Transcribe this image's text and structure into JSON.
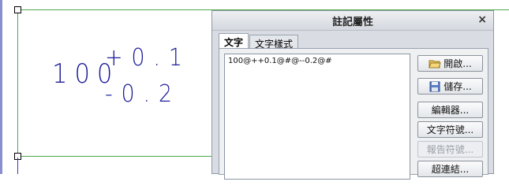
{
  "annotation": {
    "base_value": "100",
    "upper_tolerance": "+0.1",
    "lower_tolerance": "-0.2"
  },
  "dialog": {
    "title": "註記屬性",
    "close_symbol": "×",
    "tabs": [
      {
        "label": "文字",
        "active": true
      },
      {
        "label": "文字樣式",
        "active": false
      }
    ],
    "text_value": "100@++0.1@#@--0.2@#",
    "buttons": [
      {
        "label": "開啟...",
        "icon": "folder-open-icon",
        "enabled": true
      },
      {
        "label": "儲存...",
        "icon": "save-disk-icon",
        "enabled": true
      },
      {
        "label": "編輯器...",
        "enabled": true
      },
      {
        "label": "文字符號...",
        "enabled": true
      },
      {
        "label": "報告符號...",
        "enabled": false
      },
      {
        "label": "超連結...",
        "enabled": true
      }
    ]
  },
  "colors": {
    "annotation": "#1d1d9a",
    "border_green": "#4aa84a",
    "dialog_bg": "#d9dde3"
  }
}
